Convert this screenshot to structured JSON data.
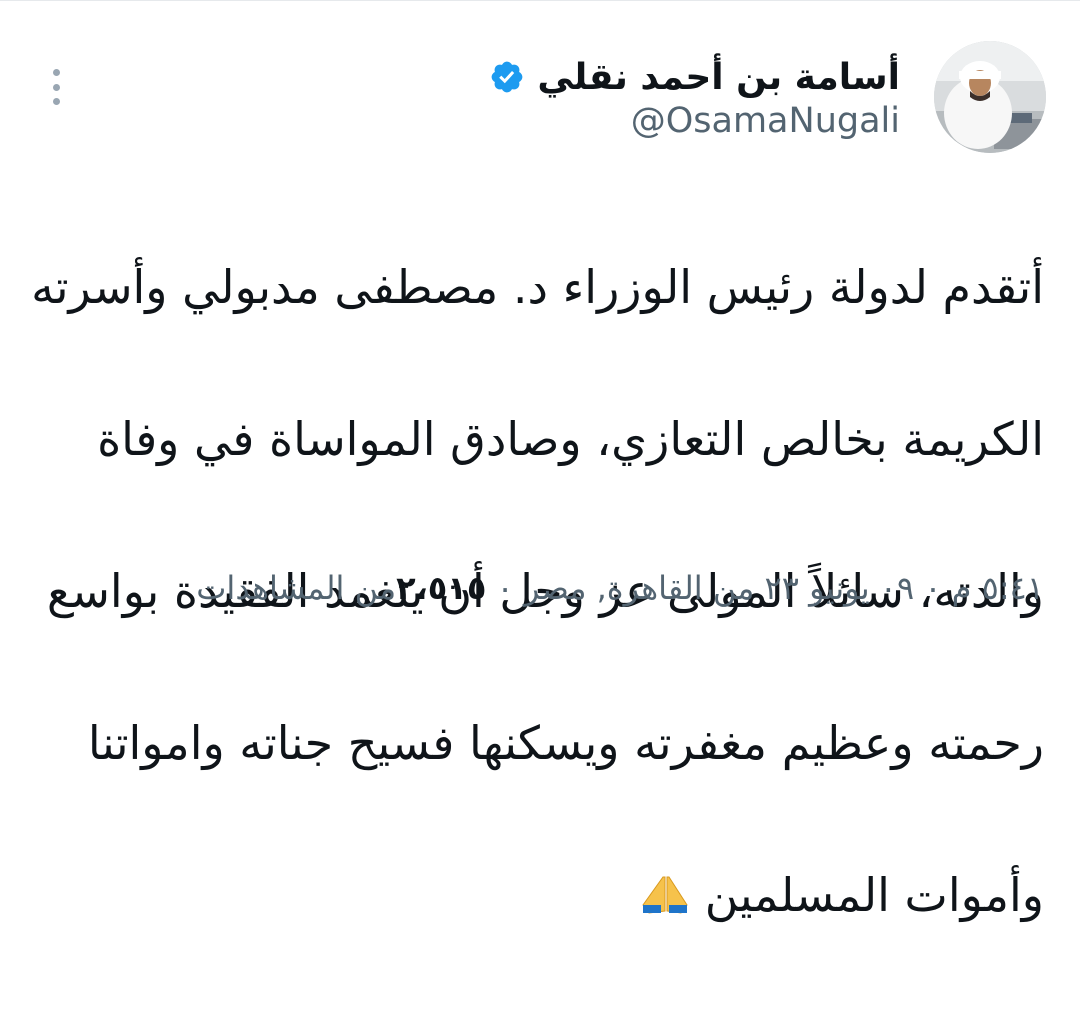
{
  "author": {
    "display_name": "أسامة بن أحمد نقلي",
    "handle": "@OsamaNugali",
    "verified": true
  },
  "tweet": {
    "lines": [
      "أتقدم لدولة رئيس الوزراء د. مصطفى مدبولي وأسرته",
      "الكريمة بخالص التعازي،  وصادق المواساة في وفاة",
      "والدته،  سائلاً المولى عز وجل أن يتغمد الفقيدة بواسع",
      "رحمته وعظيم مغفرته ويسكنها فسيح جناته وامواتنا",
      "وأموات المسلمين"
    ],
    "emoji_icon": "folded-hands-icon"
  },
  "meta": {
    "time_location": "٥:٤١ م ۰ ۰٩ يونيو ٢٣ من القاهرة, مصر ۰ ",
    "views_count": "٢،٥١٥",
    "views_label": "من المشاهدات"
  },
  "colors": {
    "verified_blue": "#1d9bf0",
    "secondary_text": "#536471",
    "primary_text": "#0f1419"
  }
}
